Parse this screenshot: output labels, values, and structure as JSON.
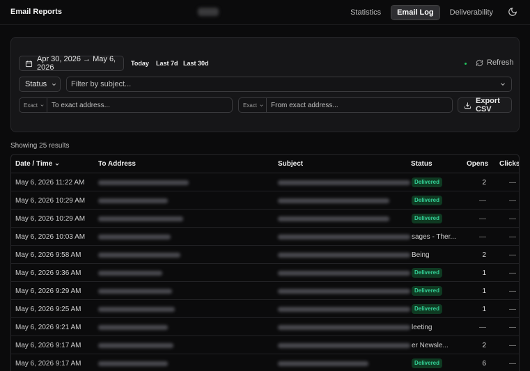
{
  "header": {
    "brand": "Email Reports",
    "tabs": [
      {
        "label": "Statistics",
        "active": false
      },
      {
        "label": "Email Log",
        "active": true
      },
      {
        "label": "Deliverability",
        "active": false
      }
    ],
    "theme_icon": "moon-icon"
  },
  "filters": {
    "date_range": "Apr 30, 2026 → May 6, 2026",
    "quick_ranges": [
      "Today",
      "Last 7d",
      "Last 30d"
    ],
    "refresh_label": "Refresh",
    "status_label": "Status",
    "subject_placeholder": "Filter by subject...",
    "to_mode": "Exact",
    "to_placeholder": "To exact address...",
    "from_mode": "Exact",
    "from_placeholder": "From exact address...",
    "export_label": "Export CSV"
  },
  "results_label": "Showing 25 results",
  "table": {
    "columns": [
      "Date / Time",
      "To Address",
      "Subject",
      "Status",
      "Opens",
      "Clicks"
    ],
    "rows": [
      {
        "date": "May 6, 2026 11:22 AM",
        "status": "Delivered",
        "overflow": "",
        "opens": "2",
        "clicks": "—"
      },
      {
        "date": "May 6, 2026 10:29 AM",
        "status": "Delivered",
        "overflow": "",
        "opens": "—",
        "clicks": "—"
      },
      {
        "date": "May 6, 2026 10:29 AM",
        "status": "Delivered",
        "overflow": "",
        "opens": "—",
        "clicks": "—"
      },
      {
        "date": "May 6, 2026 10:03 AM",
        "status": "",
        "overflow": "sages - Ther...",
        "opens": "—",
        "clicks": "—"
      },
      {
        "date": "May 6, 2026 9:58 AM",
        "status": "",
        "overflow": "Being",
        "opens": "2",
        "clicks": "—"
      },
      {
        "date": "May 6, 2026 9:36 AM",
        "status": "Delivered",
        "overflow": "",
        "opens": "1",
        "clicks": "—"
      },
      {
        "date": "May 6, 2026 9:29 AM",
        "status": "Delivered",
        "overflow": "",
        "opens": "1",
        "clicks": "—"
      },
      {
        "date": "May 6, 2026 9:25 AM",
        "status": "Delivered",
        "overflow": "",
        "opens": "1",
        "clicks": "—"
      },
      {
        "date": "May 6, 2026 9:21 AM",
        "status": "",
        "overflow": "leeting",
        "opens": "—",
        "clicks": "—"
      },
      {
        "date": "May 6, 2026 9:17 AM",
        "status": "",
        "overflow": "er Newsle...",
        "opens": "2",
        "clicks": "—"
      },
      {
        "date": "May 6, 2026 9:17 AM",
        "status": "Delivered",
        "overflow": "",
        "opens": "6",
        "clicks": "—"
      }
    ]
  },
  "colors": {
    "background": "#0b0b0c",
    "panel": "#161618",
    "delivered_text": "#34d399",
    "delivered_bg": "#0f3a22",
    "live_dot": "#22c55e"
  }
}
